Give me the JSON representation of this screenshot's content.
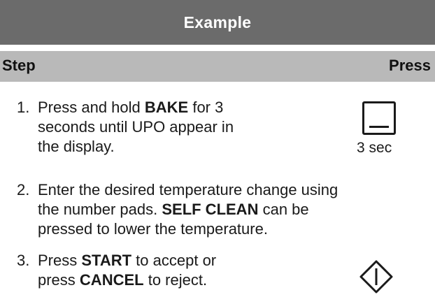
{
  "title": "Example",
  "header": {
    "step": "Step",
    "press": "Press"
  },
  "steps": [
    {
      "number": "1.",
      "lines": [
        {
          "pre": "Press and hold ",
          "bold": "BAKE",
          "post": " for 3"
        },
        {
          "text": "seconds until UPO appear in"
        },
        {
          "text": "the display."
        }
      ],
      "press_icon": "bake-key-icon",
      "press_label": "3 sec"
    },
    {
      "number": "2.",
      "lines": [
        {
          "text": "Enter the desired temperature change using"
        },
        {
          "pre": "the number pads. ",
          "bold": "SELF CLEAN",
          "post": " can be"
        },
        {
          "text": "pressed to lower the temperature."
        }
      ]
    },
    {
      "number": "3.",
      "lines": [
        {
          "pre": "Press ",
          "bold": "START",
          "post": " to accept or"
        },
        {
          "pre": "press ",
          "bold": "CANCEL",
          "post": " to reject."
        }
      ],
      "press_icon": "start-icon"
    }
  ]
}
